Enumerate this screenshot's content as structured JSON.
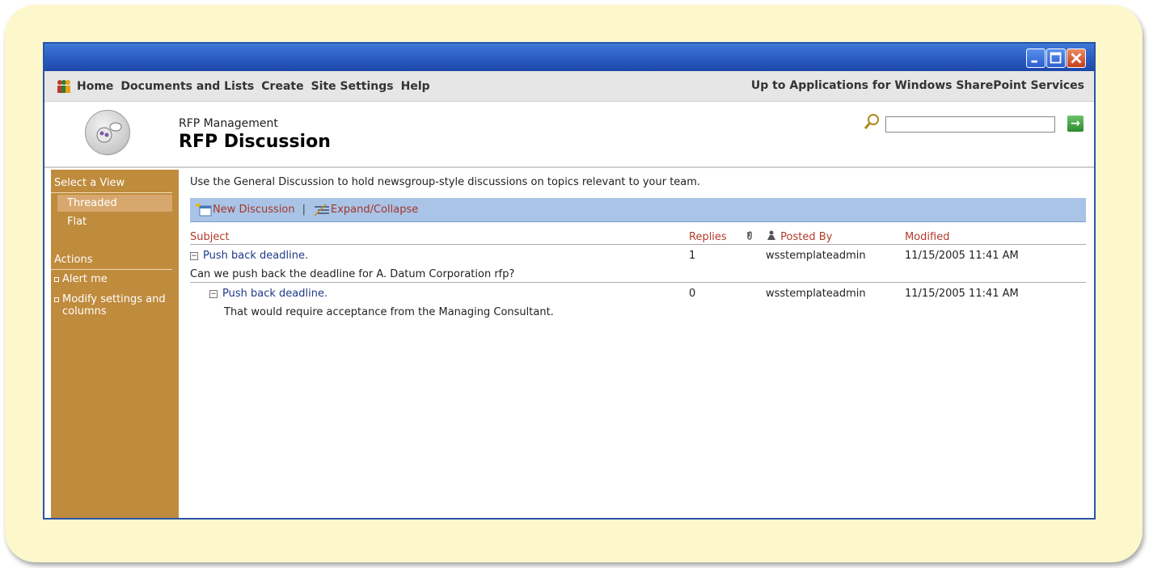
{
  "nav": {
    "items": [
      "Home",
      "Documents and Lists",
      "Create",
      "Site Settings",
      "Help"
    ],
    "right_link": "Up to Applications for Windows SharePoint Services"
  },
  "header": {
    "subtitle": "RFP Management",
    "title": "RFP Discussion",
    "go_label": "→"
  },
  "sidebar": {
    "views_heading": "Select a View",
    "views": [
      "Threaded",
      "Flat"
    ],
    "actions_heading": "Actions",
    "actions": [
      "Alert me",
      "Modify settings and columns"
    ]
  },
  "content": {
    "description": "Use the General Discussion to hold newsgroup-style discussions on topics relevant to your team.",
    "toolbar": {
      "new_discussion": "New Discussion",
      "separator": "|",
      "expand_collapse": "Expand/Collapse"
    },
    "columns": {
      "subject": "Subject",
      "replies": "Replies",
      "posted_by": "Posted By",
      "modified": "Modified"
    },
    "rows": [
      {
        "subject": "Push back deadline.",
        "body": "Can we push back the deadline for A. Datum Corporation rfp?",
        "replies": "1",
        "posted_by": "wsstemplateadmin",
        "modified": "11/15/2005 11:41 AM"
      },
      {
        "subject": "Push back deadline.",
        "body": "That would require acceptance from the Managing Consultant.",
        "replies": "0",
        "posted_by": "wsstemplateadmin",
        "modified": "11/15/2005 11:41 AM"
      }
    ]
  },
  "colors": {
    "titlebar": "#2a5bc2",
    "sidebar": "#bf8b3c",
    "toolbar": "#a9c4e6",
    "link_red": "#b23b2c",
    "frame_bg": "#fdf7cc"
  }
}
